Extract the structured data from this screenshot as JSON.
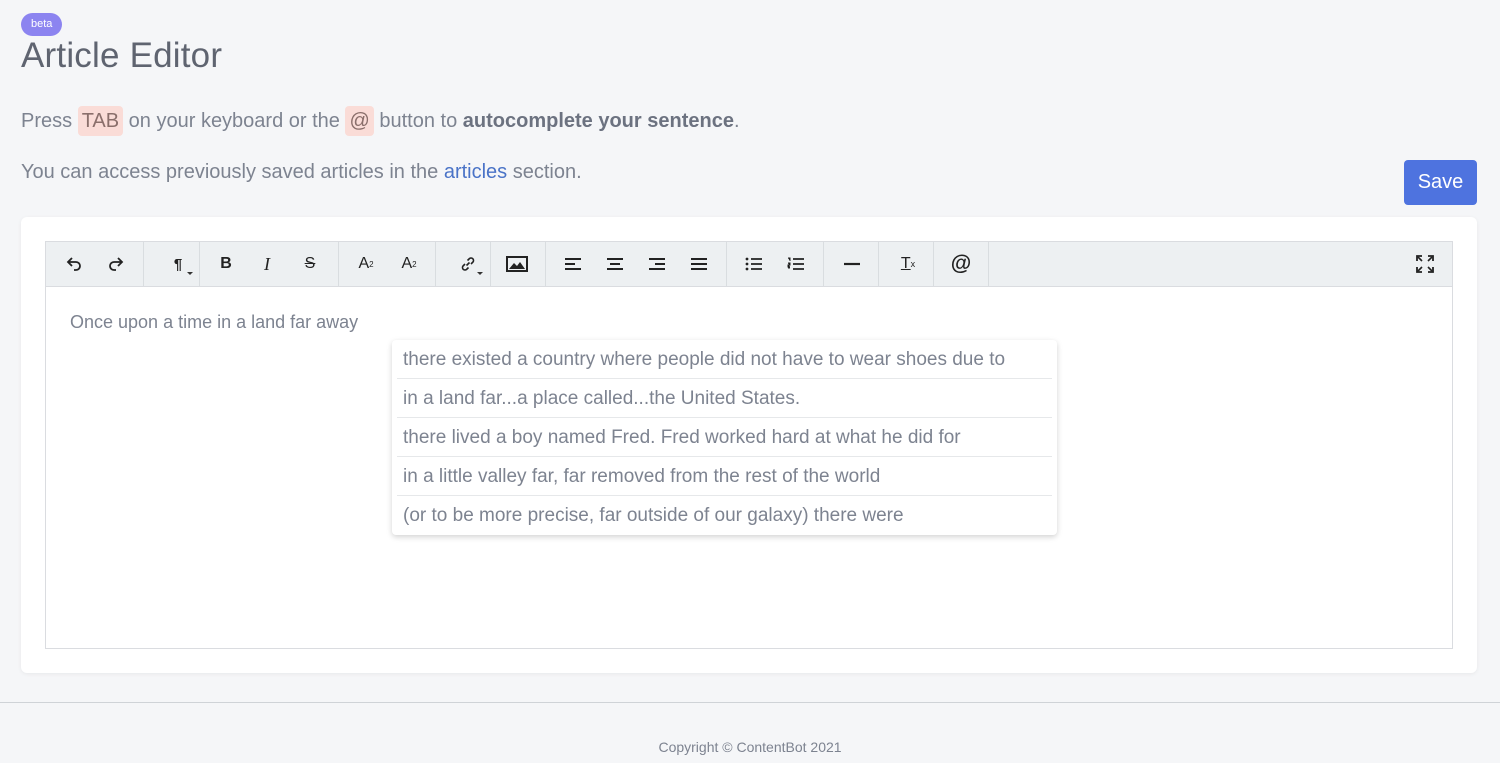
{
  "header": {
    "badge": "beta",
    "title": "Article Editor"
  },
  "instructions": {
    "line1_press": "Press",
    "line1_key": "TAB",
    "line1_mid": "on your keyboard or the",
    "line1_at": "@",
    "line1_to": "button to",
    "line1_bold": "autocomplete your sentence",
    "line1_end": ".",
    "line2_start": "You can access previously saved articles in the",
    "line2_link": "articles",
    "line2_end": "section."
  },
  "save_button": "Save",
  "toolbar": {
    "buttons": [
      {
        "name": "undo-icon"
      },
      {
        "name": "redo-icon"
      },
      {
        "name": "paragraph-format-icon"
      },
      {
        "name": "bold-icon",
        "glyph": "B"
      },
      {
        "name": "italic-icon",
        "glyph": "I"
      },
      {
        "name": "strikethrough-icon",
        "glyph": "S"
      },
      {
        "name": "superscript-icon",
        "glyph": "A"
      },
      {
        "name": "subscript-icon",
        "glyph": "A"
      },
      {
        "name": "link-icon"
      },
      {
        "name": "image-icon"
      },
      {
        "name": "align-left-icon"
      },
      {
        "name": "align-center-icon"
      },
      {
        "name": "align-right-icon"
      },
      {
        "name": "align-justify-icon"
      },
      {
        "name": "bullet-list-icon"
      },
      {
        "name": "numbered-list-icon"
      },
      {
        "name": "horizontal-rule-icon"
      },
      {
        "name": "clear-formatting-icon",
        "glyph": "T"
      },
      {
        "name": "autocomplete-at-icon",
        "glyph": "@"
      },
      {
        "name": "fullscreen-icon"
      }
    ]
  },
  "editor": {
    "text": "Once upon a time in a land far away"
  },
  "suggestions": [
    "there existed a country where people did not have to wear shoes due to",
    "in a land far...a place called...the United States.",
    "there lived a boy named Fred. Fred worked hard at what he did for",
    "in a little valley far, far removed from the rest of the world",
    "(or to be more precise, far outside of our galaxy) there were"
  ],
  "footer": {
    "copyright": "Copyright © ContentBot 2021"
  }
}
